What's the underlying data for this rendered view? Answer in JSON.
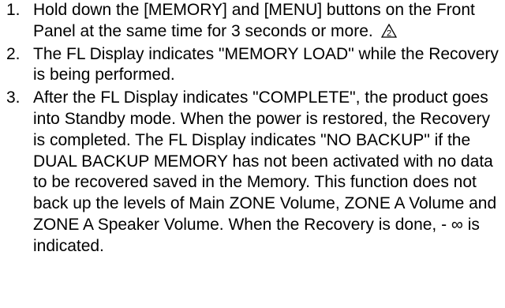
{
  "steps": [
    {
      "number": "1.",
      "text": "Hold down the [MEMORY] and [MENU] buttons on the Front Panel at the same time for 3 seconds or more.",
      "icon": "caution-2-icon",
      "icon_label": "2"
    },
    {
      "number": "2.",
      "text": "The FL Display indicates \"MEMORY LOAD\" while the Recovery is being performed."
    },
    {
      "number": "3.",
      "text": "After the FL Display indicates \"COMPLETE\", the product goes into Standby mode. When the power is restored, the Recovery is completed. The FL Display indicates \"NO BACKUP\" if the DUAL BACKUP MEMORY has not been activated with no data to be recovered saved in the Memory. This function does not back up the levels of Main ZONE Volume, ZONE A Volume and ZONE A Speaker Volume. When the Recovery is done, - ∞ is indicated."
    }
  ]
}
